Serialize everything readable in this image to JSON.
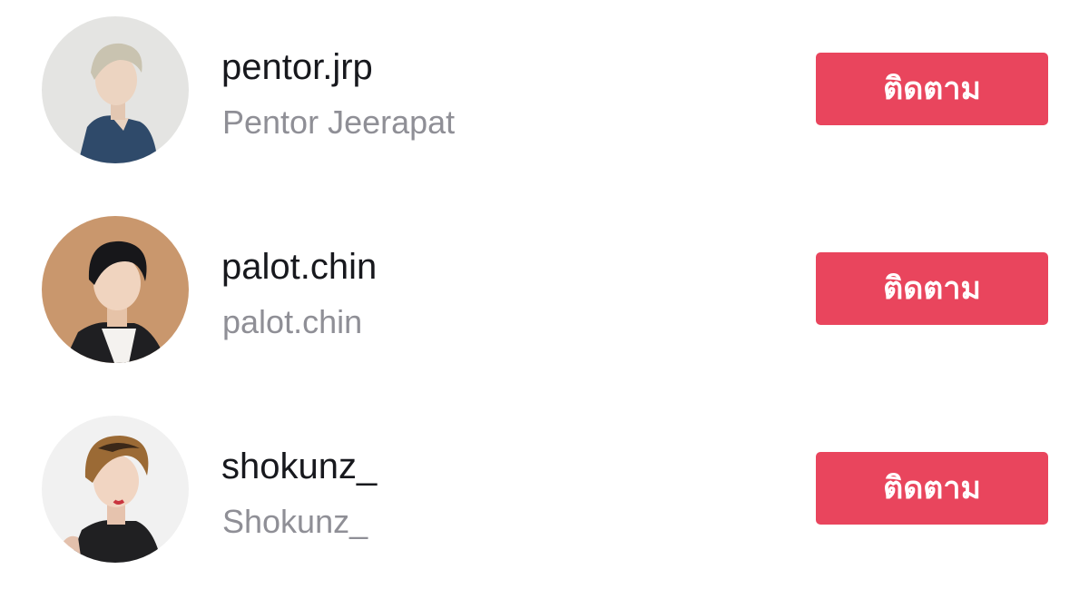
{
  "colors": {
    "button_background": "#e9455d",
    "button_text": "#ffffff",
    "username": "#17181d",
    "display_name": "#8f8f96",
    "background": "#ffffff"
  },
  "suggestions": [
    {
      "username": "pentor.jrp",
      "display_name": "Pentor Jeerapat",
      "follow_label": "ติดตาม",
      "avatar_icon": "avatar-photo"
    },
    {
      "username": "palot.chin",
      "display_name": "palot.chin",
      "follow_label": "ติดตาม",
      "avatar_icon": "avatar-photo"
    },
    {
      "username": "shokunz_",
      "display_name": "Shokunz_",
      "follow_label": "ติดตาม",
      "avatar_icon": "avatar-photo"
    }
  ]
}
